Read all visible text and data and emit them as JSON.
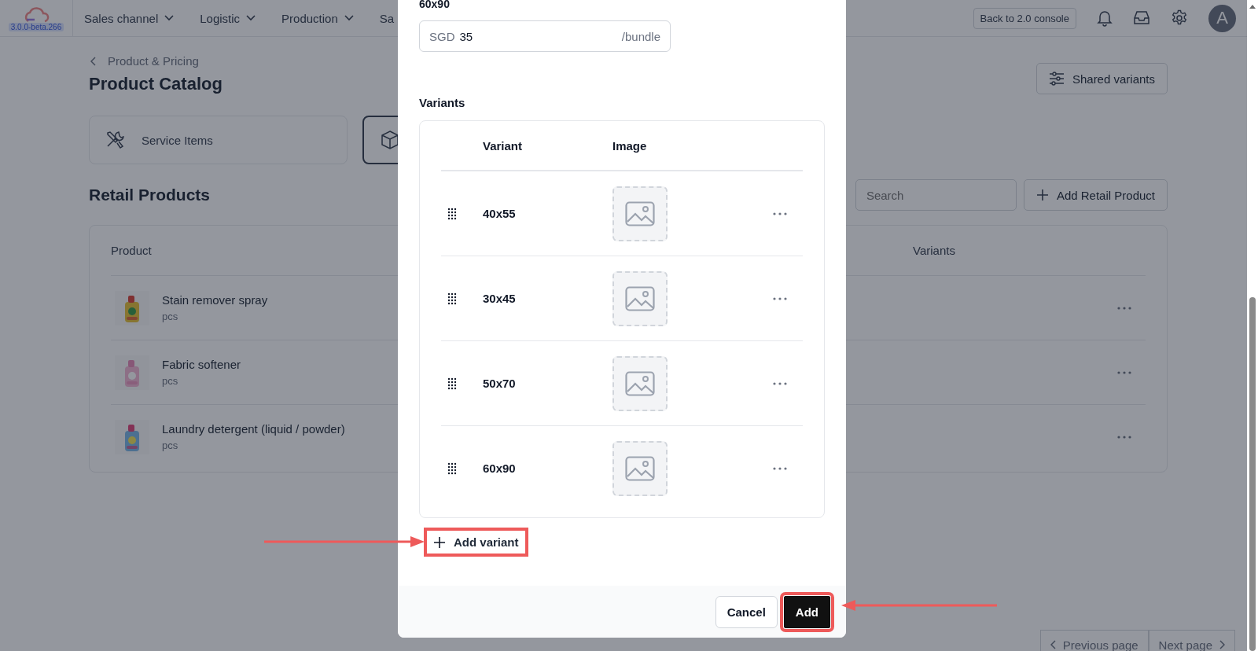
{
  "topbar": {
    "version": "3.0.0-beta.266",
    "nav": [
      {
        "label": "Sales channel",
        "dropdown": true
      },
      {
        "label": "Logistic",
        "dropdown": true
      },
      {
        "label": "Production",
        "dropdown": true
      },
      {
        "label": "Sa",
        "dropdown": false
      }
    ],
    "console_button": "Back to 2.0 console",
    "avatar": "A"
  },
  "page": {
    "breadcrumb": "Product & Pricing",
    "title": "Product Catalog",
    "shared_variants_button": "Shared variants",
    "categories": [
      {
        "kind": "service",
        "label": "Service Items",
        "selected": false
      },
      {
        "kind": "product",
        "selected": true
      }
    ],
    "section_title": "Retail Products",
    "search": {
      "placeholder": "Search"
    },
    "add_button": "Add Retail Product",
    "table": {
      "columns": [
        "Product",
        "Variants"
      ],
      "rows": [
        {
          "name": "Stain remover spray",
          "unit": "pcs"
        },
        {
          "name": "Fabric softener",
          "unit": "pcs"
        },
        {
          "name": "Laundry detergent (liquid / powder)",
          "unit": "pcs"
        }
      ]
    },
    "pagination": [
      "Previous page",
      "Next page"
    ]
  },
  "modal": {
    "label": "60x90",
    "price": {
      "prefix": "SGD",
      "value": "35",
      "suffix": "/bundle"
    },
    "variants_label": "Variants",
    "variant_columns": [
      "Variant",
      "Image"
    ],
    "variants": [
      {
        "name": "40x55"
      },
      {
        "name": "30x45"
      },
      {
        "name": "50x70"
      },
      {
        "name": "60x90"
      }
    ],
    "add_variant": {
      "label": "Add variant",
      "highlighted": true
    },
    "buttons": [
      {
        "label": "Cancel",
        "kind": "secondary",
        "highlighted": false
      },
      {
        "label": "Add",
        "kind": "primary",
        "highlighted": true
      }
    ]
  }
}
